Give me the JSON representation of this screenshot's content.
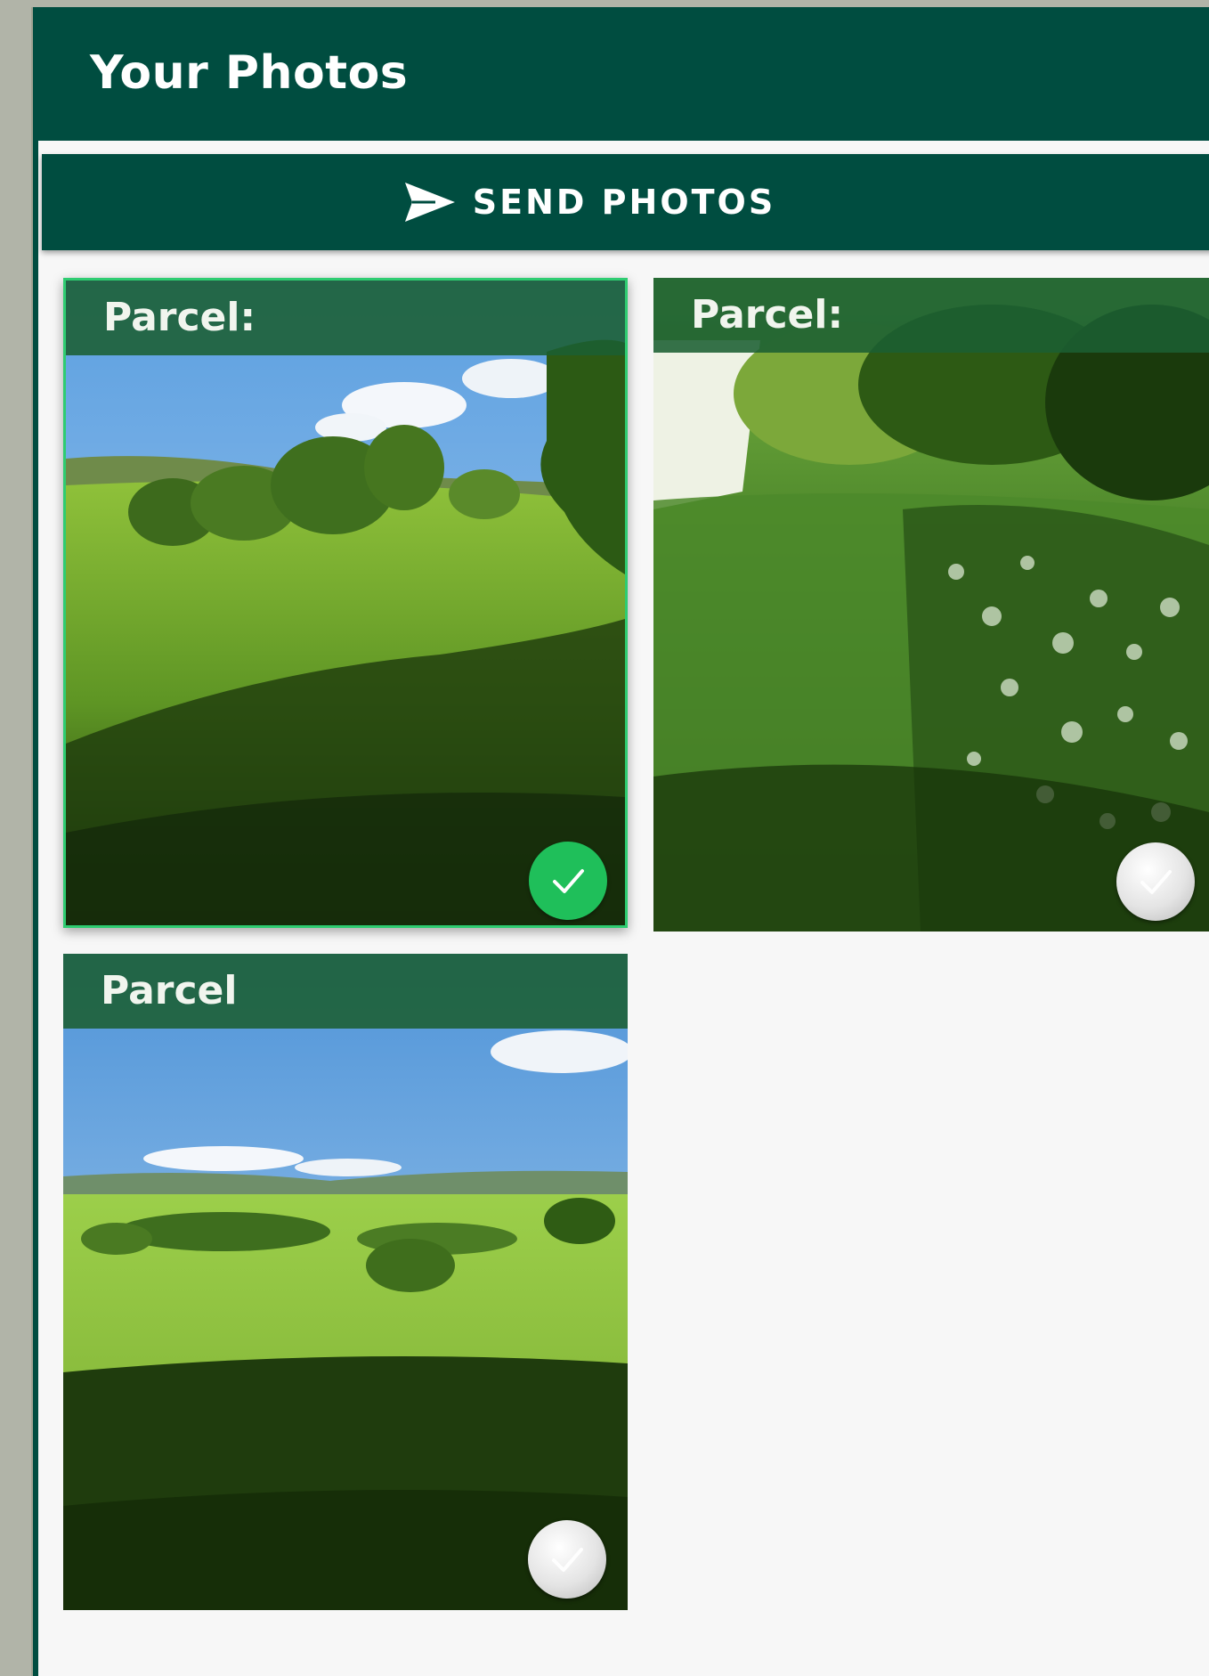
{
  "app": {
    "title": "Your Photos"
  },
  "toolbar": {
    "send_label": "SEND PHOTOS",
    "send_icon": "send-icon"
  },
  "photos": [
    {
      "title": "Parcel:",
      "selected": true,
      "scene": "field with trees and blue sky"
    },
    {
      "title": "Parcel:",
      "selected": false,
      "scene": "hedgerow with wildflowers"
    },
    {
      "title": "Parcel",
      "selected": false,
      "scene": "open pasture with distant hills"
    }
  ],
  "colors": {
    "primary": "#004d40",
    "card_header": "#1b5e32",
    "selected_check": "#1fbf5a",
    "selected_border": "#2ecc71",
    "background": "#f7f7f7"
  }
}
